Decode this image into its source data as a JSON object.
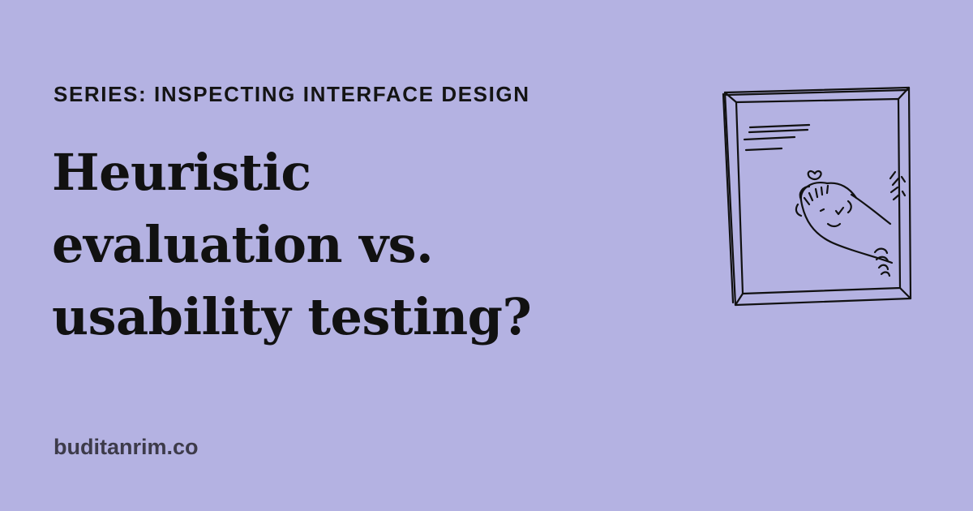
{
  "series_label": "SERIES: INSPECTING INTERFACE DESIGN",
  "title_lines": [
    "Heuristic",
    "evaluation vs.",
    "usability testing?"
  ],
  "domain": "buditanrim.co",
  "illustration_icon": "person-peeking-into-window-sketch",
  "colors": {
    "background": "#b4b2e2",
    "text": "#111111",
    "domain_text": "#3d3b4a",
    "sketch_stroke": "#111111"
  }
}
